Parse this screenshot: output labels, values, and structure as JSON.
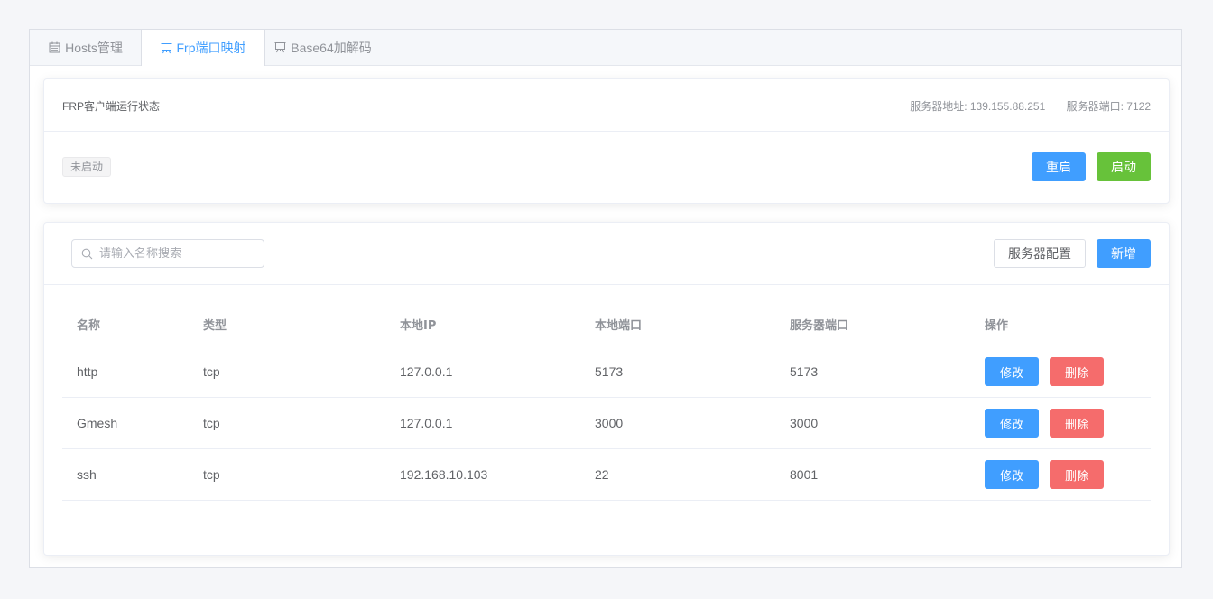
{
  "tabs": [
    {
      "label": "Hosts管理",
      "icon": "calendar-icon",
      "active": false
    },
    {
      "label": "Frp端口映射",
      "icon": "easel-icon",
      "active": true
    },
    {
      "label": "Base64加解码",
      "icon": "easel-icon",
      "active": false
    }
  ],
  "status": {
    "title": "FRP客户端运行状态",
    "server_address": "服务器地址: 139.155.88.251",
    "server_port": "服务器端口: 7122",
    "state_tag": "未启动",
    "restart_label": "重启",
    "start_label": "启动"
  },
  "toolbar": {
    "search_placeholder": "请输入名称搜索",
    "server_config_label": "服务器配置",
    "add_label": "新增"
  },
  "table": {
    "columns": [
      "名称",
      "类型",
      "本地IP",
      "本地端口",
      "服务器端口",
      "操作"
    ],
    "rows": [
      {
        "name": "http",
        "type": "tcp",
        "local_ip": "127.0.0.1",
        "local_port": "5173",
        "server_port": "5173"
      },
      {
        "name": "Gmesh",
        "type": "tcp",
        "local_ip": "127.0.0.1",
        "local_port": "3000",
        "server_port": "3000"
      },
      {
        "name": "ssh",
        "type": "tcp",
        "local_ip": "192.168.10.103",
        "local_port": "22",
        "server_port": "8001"
      }
    ],
    "edit_label": "修改",
    "delete_label": "删除"
  },
  "colors": {
    "primary": "#409eff",
    "success": "#67c23a",
    "danger": "#f56c6c"
  }
}
